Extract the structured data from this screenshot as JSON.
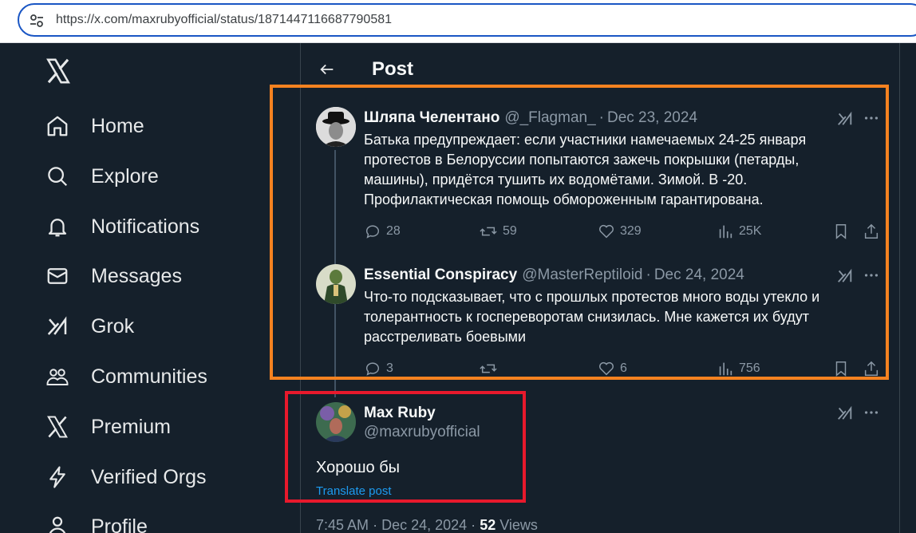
{
  "browser": {
    "url": "https://x.com/maxrubyofficial/status/1871447116687790581"
  },
  "sidebar": {
    "logo": "x-logo",
    "items": [
      {
        "label": "Home",
        "icon": "home-icon"
      },
      {
        "label": "Explore",
        "icon": "search-icon"
      },
      {
        "label": "Notifications",
        "icon": "bell-icon"
      },
      {
        "label": "Messages",
        "icon": "envelope-icon"
      },
      {
        "label": "Grok",
        "icon": "grok-icon"
      },
      {
        "label": "Communities",
        "icon": "people-icon"
      },
      {
        "label": "Premium",
        "icon": "x-icon"
      },
      {
        "label": "Verified Orgs",
        "icon": "lightning-icon"
      },
      {
        "label": "Profile",
        "icon": "person-icon"
      }
    ]
  },
  "header": {
    "title": "Post"
  },
  "tweets": [
    {
      "author": "Шляпа Челентано",
      "handle": "@_Flagman_",
      "date": "Dec 23, 2024",
      "lines": [
        "Батька предупреждает: если участники намечаемых 24-25 января",
        "протестов в Белоруссии попытаются зажечь покрышки (петарды,",
        "машины), придётся тушить их водомётами. Зимой. В -20.",
        "Профилактическая помощь обмороженным гарантирована."
      ],
      "replies": "28",
      "reposts": "59",
      "likes": "329",
      "views": "25K"
    },
    {
      "author": "Essential Conspiracy",
      "handle": "@MasterReptiloid",
      "date": "Dec 24, 2024",
      "lines": [
        "Что-то подсказывает, что с прошлых протестов много воды утекло и",
        "толерантность к госпереворотам снизилась. Мне кажется их будут",
        "расстреливать боевыми"
      ],
      "replies": "3",
      "reposts": "",
      "likes": "6",
      "views": "756"
    }
  ],
  "main_post": {
    "author": "Max Ruby",
    "handle": "@maxrubyofficial",
    "text": "Хорошо бы",
    "translate": "Translate post",
    "time": "7:45 AM",
    "date": "Dec 24, 2024",
    "views_count": "52",
    "views_label": "Views"
  },
  "colors": {
    "background": "#15202b",
    "highlight_orange": "#f58220",
    "highlight_red": "#e8192c",
    "link": "#1d9bf0"
  }
}
